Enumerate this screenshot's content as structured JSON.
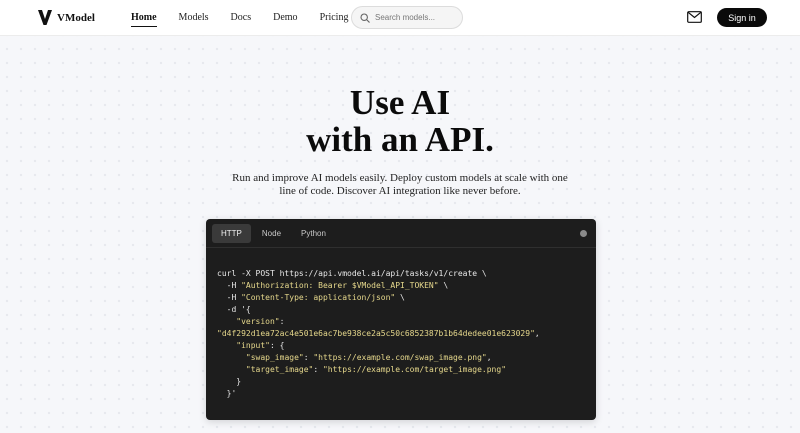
{
  "nav": {
    "brand": "VModel",
    "links": [
      {
        "label": "Home",
        "active": true
      },
      {
        "label": "Models",
        "active": false
      },
      {
        "label": "Docs",
        "active": false
      },
      {
        "label": "Demo",
        "active": false
      },
      {
        "label": "Pricing",
        "active": false
      }
    ],
    "search_placeholder": "Search models...",
    "signin_label": "Sign in",
    "icons": {
      "logo": "v-logo-icon",
      "search": "search-icon",
      "mail": "mail-icon"
    }
  },
  "hero": {
    "title_line1": "Use AI",
    "title_line2": "with an API.",
    "subtitle": "Run and improve AI models easily. Deploy custom models at scale with one line of code. Discover AI integration like never before."
  },
  "code": {
    "tabs": [
      {
        "label": "HTTP",
        "active": true
      },
      {
        "label": "Node",
        "active": false
      },
      {
        "label": "Python",
        "active": false
      }
    ],
    "lines": [
      [
        {
          "t": "curl -X POST https://api.vmodel.ai/api/tasks/v1/create \\",
          "c": ""
        }
      ],
      [
        {
          "t": "  -H ",
          "c": ""
        },
        {
          "t": "\"Authorization: Bearer $VModel_API_TOKEN\"",
          "c": "str"
        },
        {
          "t": " \\",
          "c": ""
        }
      ],
      [
        {
          "t": "  -H ",
          "c": ""
        },
        {
          "t": "\"Content-Type: application/json\"",
          "c": "str"
        },
        {
          "t": " \\",
          "c": ""
        }
      ],
      [
        {
          "t": "  -d '{",
          "c": ""
        }
      ],
      [
        {
          "t": "    ",
          "c": ""
        },
        {
          "t": "\"version\"",
          "c": "str"
        },
        {
          "t": ":",
          "c": ""
        }
      ],
      [
        {
          "t": "\"d4f292d1ea72ac4e501e6ac7be938ce2a5c50c6852387b1b64dedee01e623029\"",
          "c": "str"
        },
        {
          "t": ",",
          "c": ""
        }
      ],
      [
        {
          "t": "    ",
          "c": ""
        },
        {
          "t": "\"input\"",
          "c": "str"
        },
        {
          "t": ": {",
          "c": ""
        }
      ],
      [
        {
          "t": "      ",
          "c": ""
        },
        {
          "t": "\"swap_image\"",
          "c": "str"
        },
        {
          "t": ": ",
          "c": ""
        },
        {
          "t": "\"https://example.com/swap_image.png\"",
          "c": "str"
        },
        {
          "t": ",",
          "c": ""
        }
      ],
      [
        {
          "t": "      ",
          "c": ""
        },
        {
          "t": "\"target_image\"",
          "c": "str"
        },
        {
          "t": ": ",
          "c": ""
        },
        {
          "t": "\"https://example.com/target_image.png\"",
          "c": "str"
        }
      ],
      [
        {
          "t": "    }",
          "c": ""
        }
      ],
      [
        {
          "t": "  }'",
          "c": ""
        }
      ]
    ],
    "colors": {
      "background": "#1d1d1d",
      "string": "#e6d88c",
      "text": "#e8e8e8"
    }
  }
}
